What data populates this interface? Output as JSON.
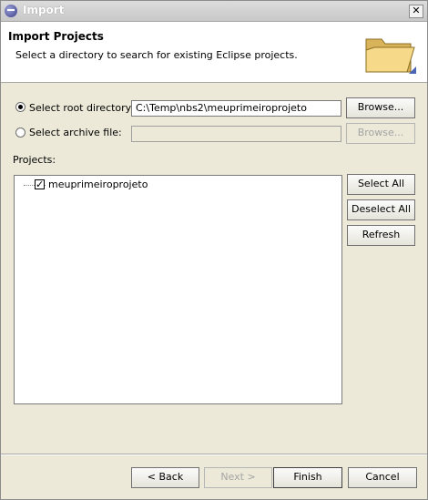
{
  "window": {
    "title": "Import",
    "close_label": "✕"
  },
  "banner": {
    "title": "Import Projects",
    "description": "Select a directory to search for existing Eclipse projects."
  },
  "source": {
    "root_dir_label": "Select root directory:",
    "root_dir_value": "C:\\Temp\\nbs2\\meuprimeiroprojeto",
    "root_dir_selected": true,
    "browse_root_label": "Browse...",
    "archive_label": "Select archive file:",
    "archive_value": "",
    "browse_archive_label": "Browse..."
  },
  "projects": {
    "label": "Projects:",
    "items": [
      {
        "name": "meuprimeiroprojeto",
        "checked": true
      }
    ],
    "select_all_label": "Select All",
    "deselect_all_label": "Deselect All",
    "refresh_label": "Refresh"
  },
  "footer": {
    "back_label": "< Back",
    "next_label": "Next >",
    "finish_label": "Finish",
    "cancel_label": "Cancel"
  },
  "colors": {
    "dialog_bg": "#ece9d8",
    "banner_bg": "#ffffff",
    "folder_fill": "#f7d98a"
  }
}
